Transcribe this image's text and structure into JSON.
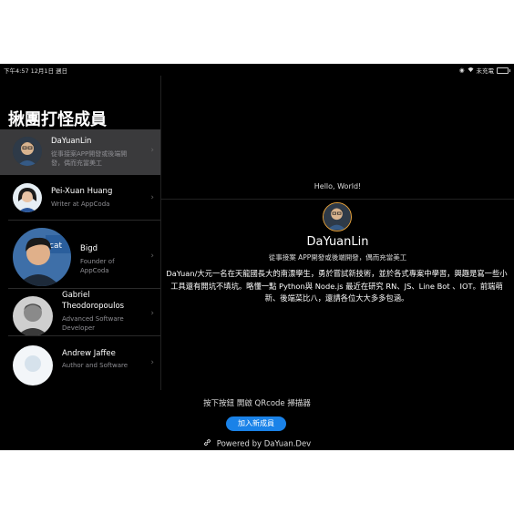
{
  "status_bar": {
    "time_date": "下午4:57  12月1日 週日",
    "wifi": "WiFi",
    "status": "未充電"
  },
  "sidebar": {
    "title": "揪團打怪成員",
    "members": [
      {
        "name": "DaYuanLin",
        "desc_lines": [
          "從事接案APP開發或後端開",
          "發，偶而充當美工"
        ],
        "selected": true
      },
      {
        "name": "Pei-Xuan Huang",
        "desc_lines": [
          "Writer at AppCoda"
        ],
        "selected": false
      },
      {
        "name": "Bigd",
        "desc_lines": [
          "Founder of",
          "AppCoda"
        ],
        "selected": false
      },
      {
        "name_lines": [
          "Gabriel",
          "Theodoropoulos"
        ],
        "desc_lines": [
          "Advanced Software",
          "Developer"
        ],
        "selected": false
      },
      {
        "name": "Andrew Jaffee",
        "desc_lines": [
          "Author and Software"
        ],
        "selected": false
      }
    ]
  },
  "detail": {
    "greeting": "Hello, World!",
    "name": "DaYuanLin",
    "role": "從事接案 APP開發或後端開發，偶而充當美工",
    "description": "DaYuan/大元一名在天龍國長大的南漂學生，勇於嘗試新技術，並於各式專案中學習，興趣是寫一些小工具還有開坑不填坑。略懂一點 Python與 Node.js 最近在研究 RN、JS、Line Bot 、IOT。前端萌新、後端菜比八，還請各位大大多多包涵。"
  },
  "footer": {
    "scan_hint": "按下按鈕  開啟 QRcode  掃描器",
    "add_button": "加入新成員",
    "powered_by": "Powered by   DaYuan.Dev"
  },
  "colors": {
    "accent": "#1a82e8",
    "background": "#000000",
    "selected_row": "#3a3a3c"
  }
}
